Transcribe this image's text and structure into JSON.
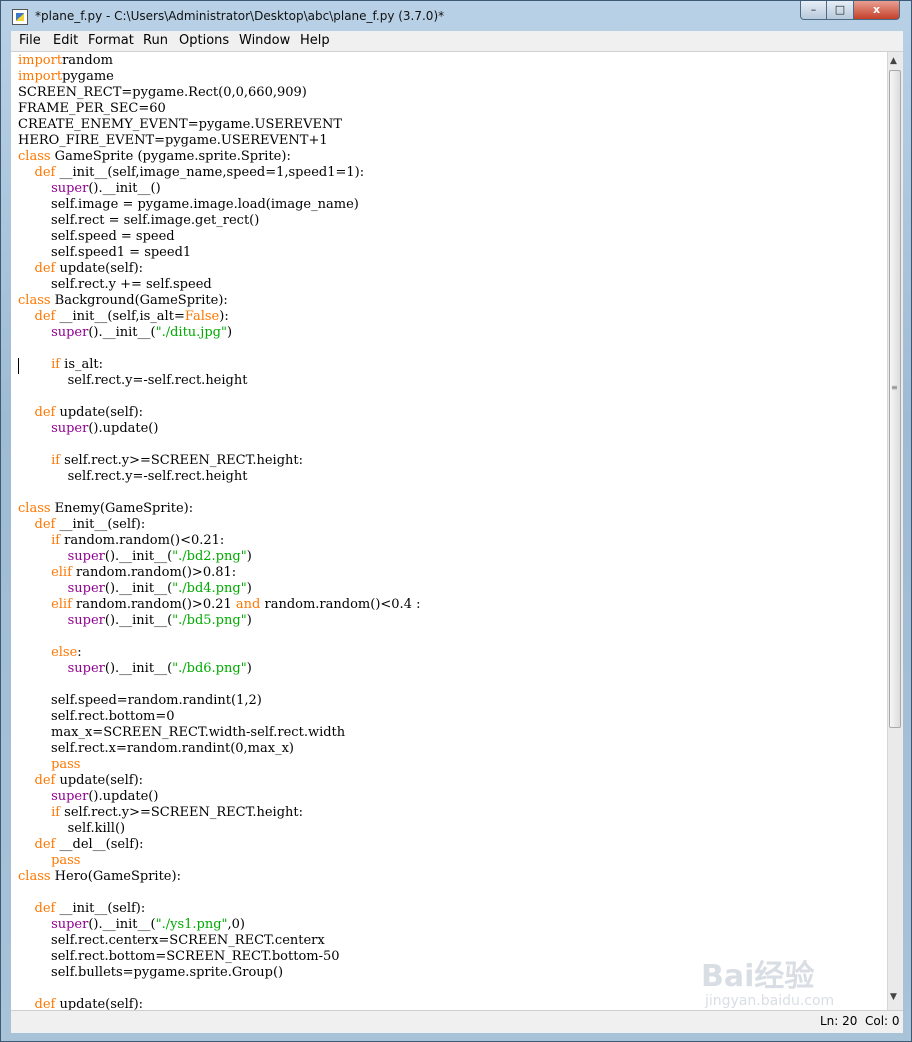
{
  "window": {
    "title": "*plane_f.py - C:\\Users\\Administrator\\Desktop\\abc\\plane_f.py (3.7.0)*",
    "minimize_label": "–",
    "maximize_label": "□",
    "close_label": "x"
  },
  "menu": [
    "File",
    "Edit",
    "Format",
    "Run",
    "Options",
    "Window",
    "Help"
  ],
  "status": {
    "line": "Ln: 20",
    "col": "Col: 0"
  },
  "watermark": {
    "logo": "Bai经验",
    "sub": "jingyan.baidu.com"
  },
  "colors": {
    "keyword": "#ff7700",
    "builtin": "#900090",
    "string": "#00aa00"
  },
  "code": [
    [
      [
        "kw",
        "import"
      ],
      [
        "",
        "random"
      ]
    ],
    [
      [
        "kw",
        "import"
      ],
      [
        "",
        "pygame"
      ]
    ],
    [
      [
        "",
        "SCREEN_RECT=pygame.Rect(0,0,660,909)"
      ]
    ],
    [
      [
        "",
        "FRAME_PER_SEC=60"
      ]
    ],
    [
      [
        "",
        "CREATE_ENEMY_EVENT=pygame.USEREVENT"
      ]
    ],
    [
      [
        "",
        "HERO_FIRE_EVENT=pygame.USEREVENT+1"
      ]
    ],
    [
      [
        "kw",
        "class"
      ],
      [
        "",
        " GameSprite (pygame.sprite.Sprite):"
      ]
    ],
    [
      [
        "",
        "    "
      ],
      [
        "kw",
        "def"
      ],
      [
        "",
        " __init__(self,image_name,speed=1,speed1=1):"
      ]
    ],
    [
      [
        "",
        "        "
      ],
      [
        "bi",
        "super"
      ],
      [
        "",
        "().__init__()"
      ]
    ],
    [
      [
        "",
        "        self.image = pygame.image.load(image_name)"
      ]
    ],
    [
      [
        "",
        "        self.rect = self.image.get_rect()"
      ]
    ],
    [
      [
        "",
        "        self.speed = speed"
      ]
    ],
    [
      [
        "",
        "        self.speed1 = speed1"
      ]
    ],
    [
      [
        "",
        "    "
      ],
      [
        "kw",
        "def"
      ],
      [
        "",
        " update(self):"
      ]
    ],
    [
      [
        "",
        "        self.rect.y += self.speed"
      ]
    ],
    [
      [
        "kw",
        "class"
      ],
      [
        "",
        " Background(GameSprite):"
      ]
    ],
    [
      [
        "",
        "    "
      ],
      [
        "kw",
        "def"
      ],
      [
        "",
        " __init__(self,is_alt="
      ],
      [
        "kw",
        "False"
      ],
      [
        "",
        "):"
      ]
    ],
    [
      [
        "",
        "        "
      ],
      [
        "bi",
        "super"
      ],
      [
        "",
        "().__init__("
      ],
      [
        "st",
        "\"./ditu.jpg\""
      ],
      [
        "",
        ")"
      ]
    ],
    [
      [
        "",
        ""
      ]
    ],
    [
      [
        "",
        "        "
      ],
      [
        "kw",
        "if"
      ],
      [
        "",
        " is_alt:"
      ]
    ],
    [
      [
        "",
        "            self.rect.y=-self.rect.height"
      ]
    ],
    [
      [
        "",
        ""
      ]
    ],
    [
      [
        "",
        "    "
      ],
      [
        "kw",
        "def"
      ],
      [
        "",
        " update(self):"
      ]
    ],
    [
      [
        "",
        "        "
      ],
      [
        "bi",
        "super"
      ],
      [
        "",
        "().update()"
      ]
    ],
    [
      [
        "",
        ""
      ]
    ],
    [
      [
        "",
        "        "
      ],
      [
        "kw",
        "if"
      ],
      [
        "",
        " self.rect.y>=SCREEN_RECT.height:"
      ]
    ],
    [
      [
        "",
        "            self.rect.y=-self.rect.height"
      ]
    ],
    [
      [
        "",
        ""
      ]
    ],
    [
      [
        "kw",
        "class"
      ],
      [
        "",
        " Enemy(GameSprite):"
      ]
    ],
    [
      [
        "",
        "    "
      ],
      [
        "kw",
        "def"
      ],
      [
        "",
        " __init__(self):"
      ]
    ],
    [
      [
        "",
        "        "
      ],
      [
        "kw",
        "if"
      ],
      [
        "",
        " random.random()<0.21:"
      ]
    ],
    [
      [
        "",
        "            "
      ],
      [
        "bi",
        "super"
      ],
      [
        "",
        "().__init__("
      ],
      [
        "st",
        "\"./bd2.png\""
      ],
      [
        "",
        ")"
      ]
    ],
    [
      [
        "",
        "        "
      ],
      [
        "kw",
        "elif"
      ],
      [
        "",
        " random.random()>0.81:"
      ]
    ],
    [
      [
        "",
        "            "
      ],
      [
        "bi",
        "super"
      ],
      [
        "",
        "().__init__("
      ],
      [
        "st",
        "\"./bd4.png\""
      ],
      [
        "",
        ")"
      ]
    ],
    [
      [
        "",
        "        "
      ],
      [
        "kw",
        "elif"
      ],
      [
        "",
        " random.random()>0.21 "
      ],
      [
        "kw",
        "and"
      ],
      [
        "",
        " random.random()<0.4 :"
      ]
    ],
    [
      [
        "",
        "            "
      ],
      [
        "bi",
        "super"
      ],
      [
        "",
        "().__init__("
      ],
      [
        "st",
        "\"./bd5.png\""
      ],
      [
        "",
        ")"
      ]
    ],
    [
      [
        "",
        ""
      ]
    ],
    [
      [
        "",
        "        "
      ],
      [
        "kw",
        "else"
      ],
      [
        "",
        ":"
      ]
    ],
    [
      [
        "",
        "            "
      ],
      [
        "bi",
        "super"
      ],
      [
        "",
        "().__init__("
      ],
      [
        "st",
        "\"./bd6.png\""
      ],
      [
        "",
        ")"
      ]
    ],
    [
      [
        "",
        ""
      ]
    ],
    [
      [
        "",
        "        self.speed=random.randint(1,2)"
      ]
    ],
    [
      [
        "",
        "        self.rect.bottom=0"
      ]
    ],
    [
      [
        "",
        "        max_x=SCREEN_RECT.width-self.rect.width"
      ]
    ],
    [
      [
        "",
        "        self.rect.x=random.randint(0,max_x)"
      ]
    ],
    [
      [
        "",
        "        "
      ],
      [
        "kw",
        "pass"
      ]
    ],
    [
      [
        "",
        "    "
      ],
      [
        "kw",
        "def"
      ],
      [
        "",
        " update(self):"
      ]
    ],
    [
      [
        "",
        "        "
      ],
      [
        "bi",
        "super"
      ],
      [
        "",
        "().update()"
      ]
    ],
    [
      [
        "",
        "        "
      ],
      [
        "kw",
        "if"
      ],
      [
        "",
        " self.rect.y>=SCREEN_RECT.height:"
      ]
    ],
    [
      [
        "",
        "            self.kill()"
      ]
    ],
    [
      [
        "",
        "    "
      ],
      [
        "kw",
        "def"
      ],
      [
        "",
        " __del__(self):"
      ]
    ],
    [
      [
        "",
        "        "
      ],
      [
        "kw",
        "pass"
      ]
    ],
    [
      [
        "kw",
        "class"
      ],
      [
        "",
        " Hero(GameSprite):"
      ]
    ],
    [
      [
        "",
        ""
      ]
    ],
    [
      [
        "",
        "    "
      ],
      [
        "kw",
        "def"
      ],
      [
        "",
        " __init__(self):"
      ]
    ],
    [
      [
        "",
        "        "
      ],
      [
        "bi",
        "super"
      ],
      [
        "",
        "().__init__("
      ],
      [
        "st",
        "\"./ys1.png\""
      ],
      [
        "",
        ",0)"
      ]
    ],
    [
      [
        "",
        "        self.rect.centerx=SCREEN_RECT.centerx"
      ]
    ],
    [
      [
        "",
        "        self.rect.bottom=SCREEN_RECT.bottom-50"
      ]
    ],
    [
      [
        "",
        "        self.bullets=pygame.sprite.Group()"
      ]
    ],
    [
      [
        "",
        ""
      ]
    ],
    [
      [
        "",
        "    "
      ],
      [
        "kw",
        "def"
      ],
      [
        "",
        " update(self):"
      ]
    ]
  ]
}
